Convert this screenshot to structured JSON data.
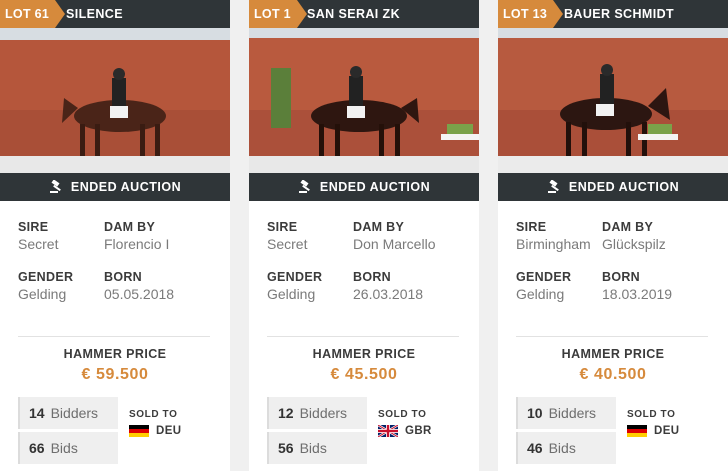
{
  "status_label": "ENDED AUCTION",
  "labels": {
    "sire": "SIRE",
    "dam_by": "DAM BY",
    "gender": "GENDER",
    "born": "BORN",
    "hammer_price": "HAMMER PRICE",
    "bidders": "Bidders",
    "bids": "Bids",
    "sold_to": "SOLD TO"
  },
  "colors": {
    "accent": "#d68a3c",
    "bar": "#2f3538"
  },
  "cards": [
    {
      "lot": "LOT 61",
      "name": "SILENCE",
      "sire": "Secret",
      "dam_by": "Florencio I",
      "gender": "Gelding",
      "born": "05.05.2018",
      "price": "€ 59.500",
      "bidders": "14",
      "bids": "66",
      "country": "DEU",
      "flag": "germany-flag"
    },
    {
      "lot": "LOT 1",
      "name": "SAN SERAI ZK",
      "sire": "Secret",
      "dam_by": "Don Marcello",
      "gender": "Gelding",
      "born": "26.03.2018",
      "price": "€ 45.500",
      "bidders": "12",
      "bids": "56",
      "country": "GBR",
      "flag": "uk-flag"
    },
    {
      "lot": "LOT 13",
      "name": "BAUER SCHMIDT",
      "sire": "Birmingham",
      "dam_by": "Glückspilz",
      "gender": "Gelding",
      "born": "18.03.2019",
      "price": "€ 40.500",
      "bidders": "10",
      "bids": "46",
      "country": "DEU",
      "flag": "germany-flag"
    }
  ]
}
